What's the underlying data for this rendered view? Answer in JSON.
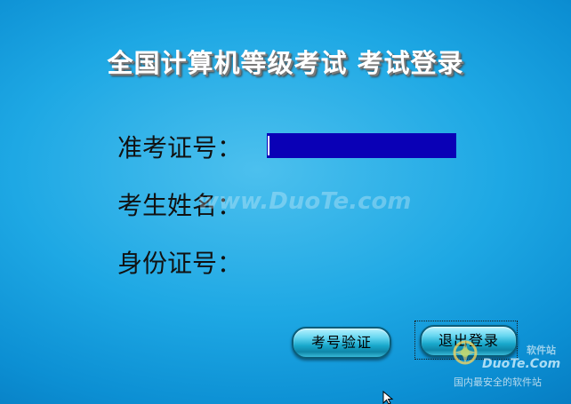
{
  "title": "全国计算机等级考试 考试登录",
  "form": {
    "exam_id_label": "准考证号：",
    "exam_id_value": "",
    "name_label": "考生姓名：",
    "name_value": "",
    "id_card_label": "身份证号：",
    "id_card_value": ""
  },
  "buttons": {
    "verify_label": "考号验证",
    "exit_label": "退出登录"
  },
  "watermark": {
    "center_text": "www.DuoTe.com",
    "brand_cn": "软件站",
    "brand_en": "DuoTe.Com",
    "brand_sub": "国内最安全的软件站"
  },
  "colors": {
    "background": "#1ea8e4",
    "selected_field": "#0a00b6",
    "button_face": "#19a9cc",
    "title_text": "#ffffff"
  },
  "icons": {
    "brand_logo": "duote-logo-icon",
    "cursor": "mouse-pointer-icon"
  }
}
